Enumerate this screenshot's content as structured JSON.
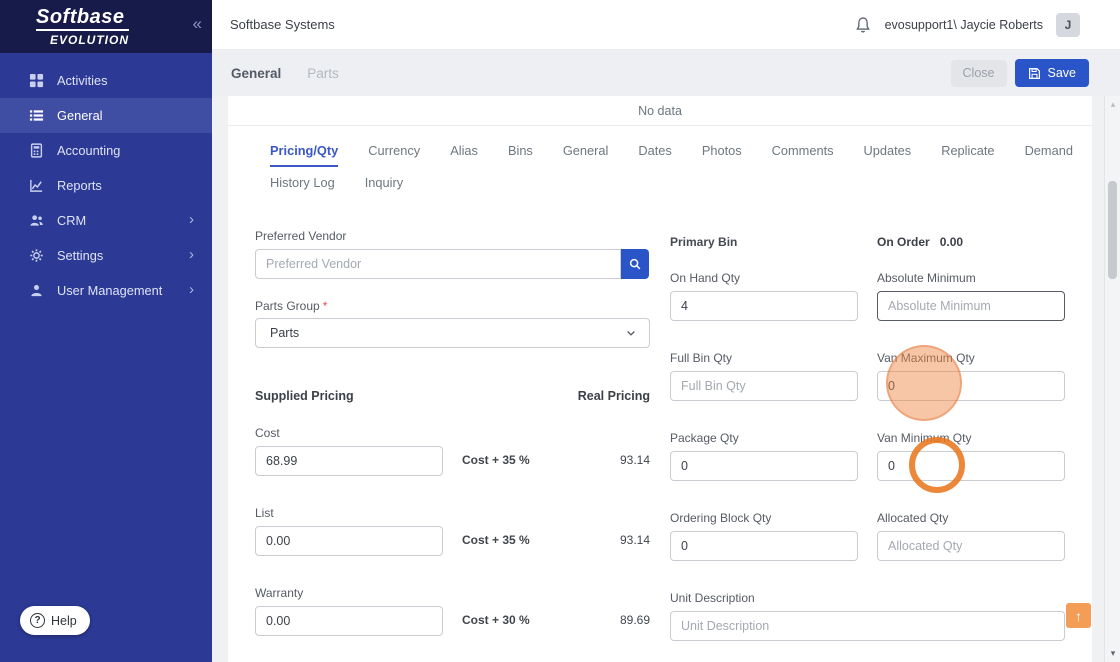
{
  "colors": {
    "sidebar": "#2c3a96",
    "sidebar_dark": "#171b49",
    "accent_blue": "#2a55c8",
    "tab_active_blue": "#3a57c4",
    "highlight_orange": "#ee7c32",
    "required_red": "#e5484d"
  },
  "icons": {
    "collapse": "«",
    "chevron_right": "›",
    "help": "?",
    "scroll_top": "↑",
    "scrollbar_up": "▴",
    "scrollbar_down": "▾"
  },
  "sidebar": {
    "logo_line1": "Softbase",
    "logo_line2": "EVOLUTION",
    "items": [
      {
        "label": "Activities"
      },
      {
        "label": "General"
      },
      {
        "label": "Accounting"
      },
      {
        "label": "Reports"
      },
      {
        "label": "CRM"
      },
      {
        "label": "Settings"
      },
      {
        "label": "User Management"
      }
    ],
    "help_label": "Help"
  },
  "topbar": {
    "title": "Softbase Systems",
    "user": "evosupport1\\ Jaycie Roberts",
    "avatar_initial": "J"
  },
  "subbar": {
    "tab_general": "General",
    "tab_parts": "Parts",
    "close_label": "Close",
    "save_label": "Save"
  },
  "main": {
    "no_data": "No data",
    "active_tab": "Pricing/Qty",
    "tabs_row1": [
      "Pricing/Qty",
      "Currency",
      "Alias",
      "Bins",
      "General",
      "Dates",
      "Photos",
      "Comments",
      "Updates",
      "Replicate",
      "Demand"
    ],
    "tabs_row2": [
      "History Log",
      "Inquiry"
    ],
    "form": {
      "preferred_vendor_label": "Preferred Vendor",
      "preferred_vendor_placeholder": "Preferred Vendor",
      "parts_group_label": "Parts Group",
      "required_mark": "*",
      "parts_group_value": "Parts",
      "supplied_pricing_label": "Supplied Pricing",
      "real_pricing_label": "Real Pricing",
      "cost_label": "Cost",
      "cost_value": "68.99",
      "cost_formula": "Cost + 35 %",
      "cost_real": "93.14",
      "list_label": "List",
      "list_value": "0.00",
      "list_formula": "Cost + 35 %",
      "list_real": "93.14",
      "warranty_label": "Warranty",
      "warranty_value": "0.00",
      "warranty_formula": "Cost + 30 %",
      "warranty_real": "89.69",
      "primary_bin_label": "Primary Bin",
      "on_order_label": "On Order",
      "on_order_value": "0.00",
      "on_hand_qty_label": "On Hand Qty",
      "on_hand_qty_value": "4",
      "absolute_minimum_label": "Absolute Minimum",
      "absolute_minimum_placeholder": "Absolute Minimum",
      "full_bin_qty_label": "Full Bin Qty",
      "full_bin_qty_placeholder": "Full Bin Qty",
      "van_maximum_qty_label": "Van Maximum Qty",
      "van_maximum_qty_value": "0",
      "package_qty_label": "Package Qty",
      "package_qty_value": "0",
      "van_minimum_qty_label": "Van Minimum Qty",
      "van_minimum_qty_value": "0",
      "ordering_block_qty_label": "Ordering Block Qty",
      "ordering_block_qty_value": "0",
      "allocated_qty_label": "Allocated Qty",
      "allocated_qty_placeholder": "Allocated Qty",
      "unit_description_label": "Unit Description",
      "unit_description_placeholder": "Unit Description"
    }
  }
}
